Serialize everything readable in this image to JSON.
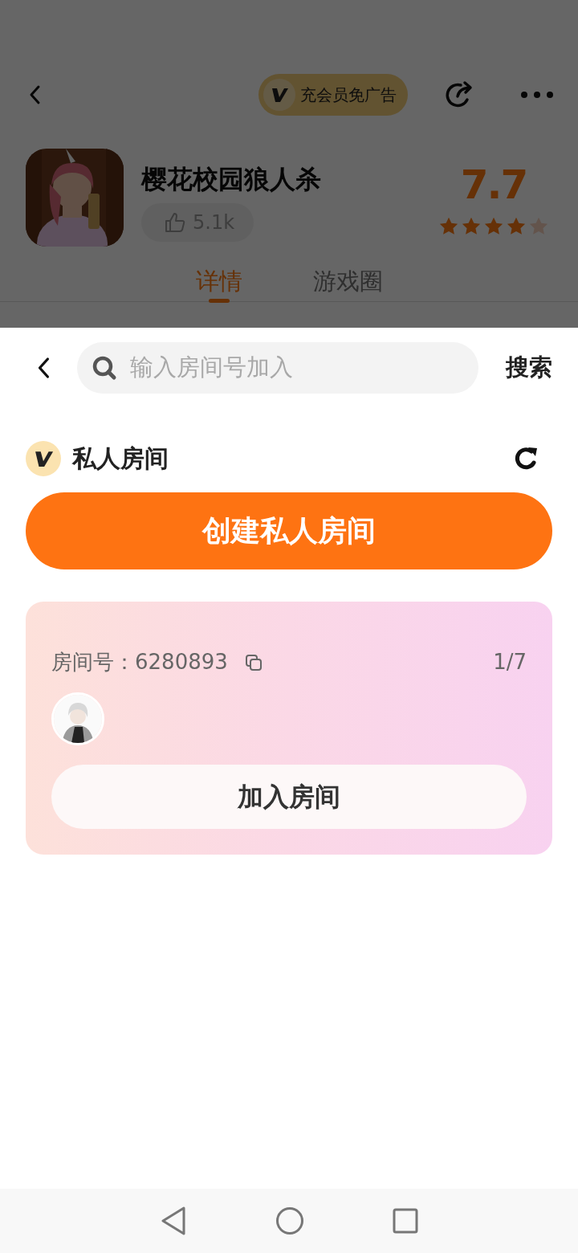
{
  "header": {
    "vip_button": "充会员免广告"
  },
  "game": {
    "title": "樱花校园狼人杀",
    "likes": "5.1k",
    "rating": "7.7",
    "stars": 4
  },
  "tabs": [
    {
      "label": "详情",
      "selected": true
    },
    {
      "label": "游戏圈",
      "selected": false
    }
  ],
  "sheet": {
    "search": {
      "placeholder": "输入房间号加入"
    },
    "search_button": "搜索",
    "section_title": "私人房间",
    "create_button": "创建私人房间",
    "rooms": [
      {
        "room_label": "房间号：6280893",
        "occupancy": "1/7",
        "join_button": "加入房间"
      }
    ]
  }
}
